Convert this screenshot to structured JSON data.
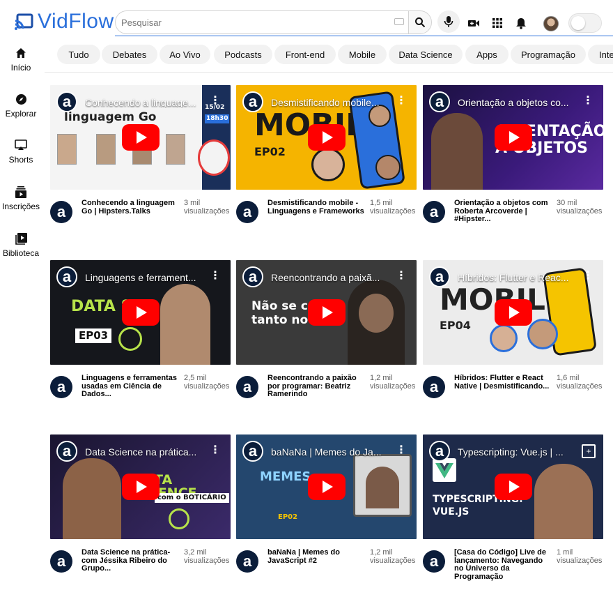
{
  "app": {
    "logo_text": "VidFlow"
  },
  "search": {
    "placeholder": "Pesquisar"
  },
  "sidebar": {
    "items": [
      {
        "label": "Início",
        "icon": "home-icon"
      },
      {
        "label": "Explorar",
        "icon": "compass-icon"
      },
      {
        "label": "Shorts",
        "icon": "shorts-icon"
      },
      {
        "label": "Inscrições",
        "icon": "subscriptions-icon"
      },
      {
        "label": "Biblioteca",
        "icon": "library-icon"
      }
    ]
  },
  "chips": [
    "Tudo",
    "Debates",
    "Ao Vivo",
    "Podcasts",
    "Front-end",
    "Mobile",
    "Data Science",
    "Apps",
    "Programação",
    "Inte"
  ],
  "videos": [
    {
      "overlay_title": "Conhecendo a linguage...",
      "title": "Conhecendo a linguagem Go | Hipsters.Talks",
      "views": "3 mil visualizações",
      "thumb_text": "linguagem Go",
      "thumb_badge": "15/02",
      "thumb_badge2": "18h30"
    },
    {
      "overlay_title": "Desmistificando mobile...",
      "title": "Desmistificando mobile - Linguagens e Frameworks",
      "views": "1,5 mil visualizações",
      "thumb_text": "MOBILE",
      "thumb_sub": "EP02"
    },
    {
      "overlay_title": "Orientação a objetos co...",
      "title": "Orientação a objetos com Roberta Arcoverde | #Hipster...",
      "views": "30 mil visualizações",
      "thumb_text": "ORIENTAÇÃO",
      "thumb_sub": "A OBJETOS"
    },
    {
      "overlay_title": "Linguagens e ferrament...",
      "title": "Linguagens e ferramentas usadas em Ciência de Dados...",
      "views": "2,5 mil visualizações",
      "thumb_text": "DATA SCI",
      "thumb_sub": "EP03"
    },
    {
      "overlay_title": "Reencontrando a paixã...",
      "title": "Reencontrando a paixão por programar: Beatriz Ramerindo",
      "views": "1,2 mil visualizações",
      "thumb_text": "Não se co",
      "thumb_sub": "tanto no i"
    },
    {
      "overlay_title": "Híbridos: Flutter e Reac...",
      "title": "Híbridos: Flutter e React Native | Desmistificando...",
      "views": "1,6 mil visualizações",
      "thumb_text": "MOBILE",
      "thumb_sub": "EP04"
    },
    {
      "overlay_title": "Data Science na prática...",
      "title": "Data Science na prática- com Jéssika Ribeiro do Grupo...",
      "views": "3,2 mil visualizações",
      "thumb_text": "DATA SCIENCE",
      "thumb_sub": "com o BOTICÁRIO"
    },
    {
      "overlay_title": "baNaNa | Memes do Ja...",
      "title": "baNaNa | Memes do JavaScript #2",
      "views": "1,2 mil visualizações",
      "thumb_text": "MEMES",
      "thumb_sub": "EP02"
    },
    {
      "overlay_title": "Typescripting: Vue.js | ...",
      "title": "[Casa do Código] Live de lançamento: Navegando no Universo da Programação",
      "views": "1 mil visualizações",
      "thumb_text": "TYPESCRIPTING:",
      "thumb_sub": "VUE.JS"
    }
  ],
  "colors": {
    "brand": "#2a6fdb",
    "play": "#ff0000",
    "channel": "#0b1d3a"
  }
}
